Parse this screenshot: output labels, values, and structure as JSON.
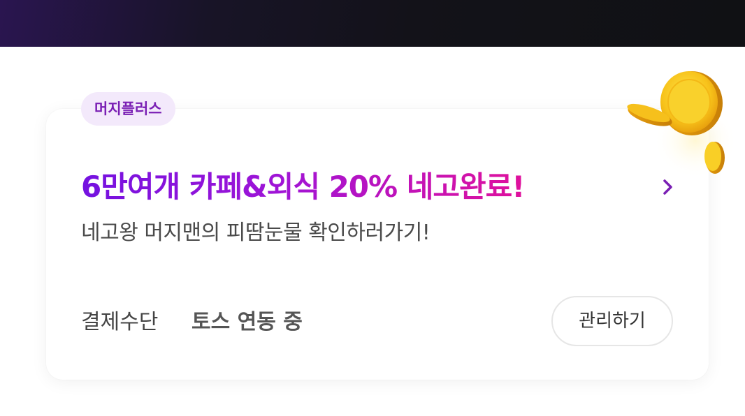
{
  "promo": {
    "badge": "머지플러스",
    "headline": "6만여개 카페&외식 20% 네고완료!",
    "subtitle": "네고왕 머지맨의 피땀눈물 확인하러가기!"
  },
  "payment": {
    "label": "결제수단",
    "value": "토스 연동 중",
    "manage_label": "관리하기"
  },
  "icons": {
    "chevron": "chevron-right-icon",
    "coins": "gold-coins-icon"
  },
  "colors": {
    "badge_bg": "#f3e9fb",
    "badge_text": "#7a1fb4",
    "headline_start": "#7412e0",
    "headline_end": "#e0119c",
    "banner_dark": "#121216"
  }
}
